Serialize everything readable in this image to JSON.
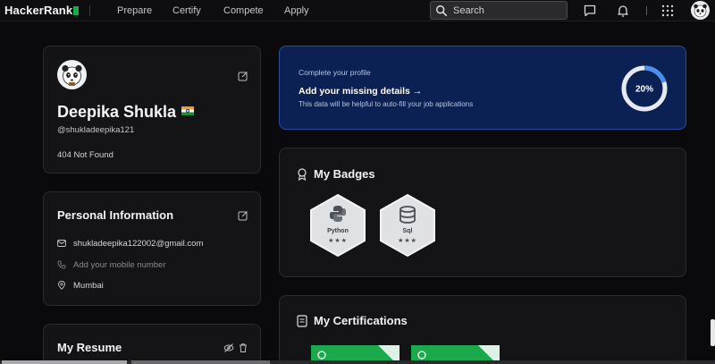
{
  "nav": {
    "logo": "HackerRank",
    "items": [
      "Prepare",
      "Certify",
      "Compete",
      "Apply"
    ],
    "search_placeholder": "Search"
  },
  "profile": {
    "name": "Deepika Shukla",
    "handle": "@shukladeepika121",
    "bio": "404 Not Found"
  },
  "personal": {
    "title": "Personal Information",
    "email": "shukladeepika122002@gmail.com",
    "phone_placeholder": "Add your mobile number",
    "location": "Mumbai"
  },
  "resume": {
    "title": "My Resume"
  },
  "complete_profile": {
    "eyebrow": "Complete your profile",
    "title": "Add your missing details",
    "arrow": "→",
    "description": "This data will be helpful to auto-fill your job applications",
    "progress_label": "20%",
    "progress": 0.2
  },
  "badges": {
    "title": "My Badges",
    "items": [
      {
        "label": "Python",
        "stars": "★★★",
        "icon": "python-icon"
      },
      {
        "label": "Sql",
        "stars": "★★★",
        "icon": "database-icon"
      }
    ]
  },
  "certifications": {
    "title": "My Certifications"
  },
  "colors": {
    "accent_green": "#1ba94c",
    "banner_bg": "#0c2153",
    "progress_ring": "#4a8ff0"
  }
}
